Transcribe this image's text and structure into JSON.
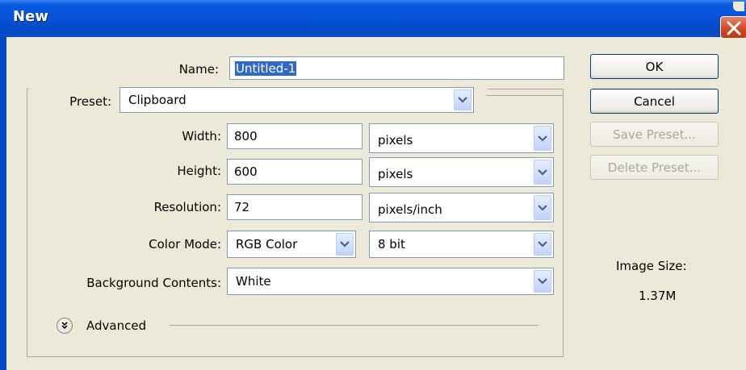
{
  "window": {
    "title": "New"
  },
  "form": {
    "name_label": "Name:",
    "name_value": "Untitled-1",
    "preset_label": "Preset:",
    "preset_value": "Clipboard",
    "width_label": "Width:",
    "width_value": "800",
    "width_unit": "pixels",
    "height_label": "Height:",
    "height_value": "600",
    "height_unit": "pixels",
    "resolution_label": "Resolution:",
    "resolution_value": "72",
    "resolution_unit": "pixels/inch",
    "color_mode_label": "Color Mode:",
    "color_mode_value": "RGB Color",
    "bit_depth_value": "8 bit",
    "background_label": "Background Contents:",
    "background_value": "White",
    "advanced_label": "Advanced"
  },
  "buttons": {
    "ok": "OK",
    "cancel": "Cancel",
    "save_preset": "Save Preset...",
    "delete_preset": "Delete Preset..."
  },
  "image_size": {
    "label": "Image Size:",
    "value": "1.37M"
  },
  "icons": {
    "dropdown": "chevron-down-icon",
    "advanced": "double-chevron-down-icon",
    "close": "close-icon"
  },
  "colors": {
    "titlebar": "#0552d6",
    "dialog_bg": "#ece9d8",
    "selection": "#316ac5",
    "close_button": "#d2471f"
  }
}
